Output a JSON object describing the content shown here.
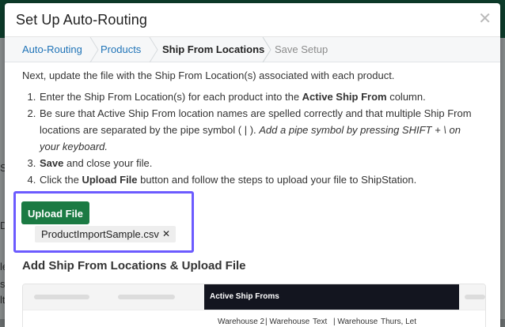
{
  "modal": {
    "title": "Set Up Auto-Routing",
    "close_icon": "close-icon"
  },
  "stepper": {
    "steps": [
      {
        "label": "Auto-Routing",
        "state": "done"
      },
      {
        "label": "Products",
        "state": "done"
      },
      {
        "label": "Ship From Locations",
        "state": "current"
      },
      {
        "label": "Save Setup",
        "state": "future"
      }
    ]
  },
  "body": {
    "intro": "Next, update the file with the Ship From Location(s) associated with each product.",
    "steps": {
      "s1_a": "Enter the Ship From Location(s) for each product into the ",
      "s1_b": "Active Ship From",
      "s1_c": " column.",
      "s2_a": "Be sure that Active Ship From location names are spelled correctly and that multiple Ship From locations are separated by the pipe symbol ( | ). ",
      "s2_b": "Add a pipe symbol by pressing SHIFT + \\ on your keyboard.",
      "s3_a": "Save",
      "s3_b": " and close your file.",
      "s4_a": "Click the ",
      "s4_b": "Upload File",
      "s4_c": " button and follow the steps to upload your file to ShipStation."
    },
    "upload_button": "Upload File",
    "file_name": "ProductImportSample.csv",
    "remove_file_icon": "close-icon",
    "section_title": "Add Ship From Locations & Upload File",
    "sheet": {
      "active_column_header": "Active Ship Froms",
      "row_cells": [
        "Warehouse 2",
        "| Warehouse",
        "Text",
        "| Warehouse",
        "Thurs, Let"
      ]
    }
  },
  "colors": {
    "primary_green": "#1b7a43",
    "link_blue": "#1f73b7",
    "highlight_purple": "#6c5bff",
    "header_dark": "#13151f"
  }
}
